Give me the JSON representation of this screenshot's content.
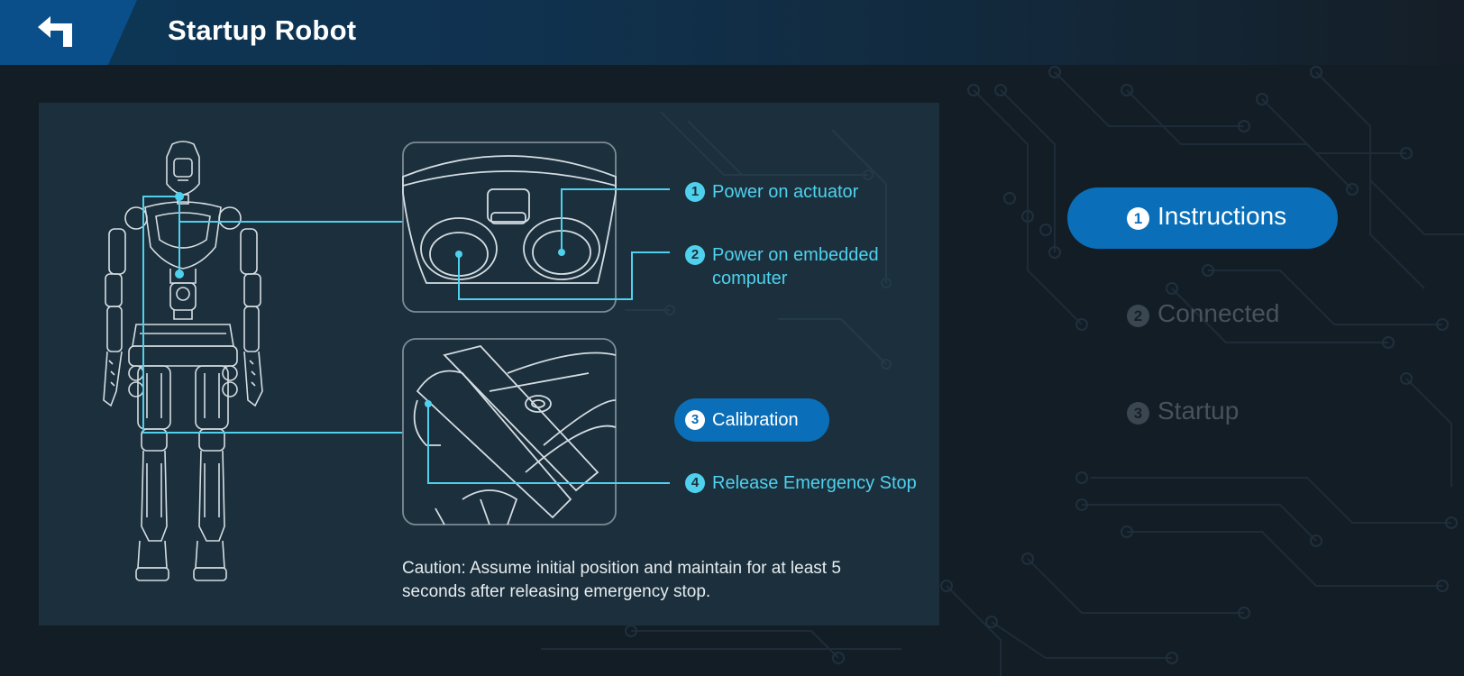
{
  "header": {
    "title": "Startup Robot",
    "back_icon": "back-arrow-icon"
  },
  "instructions": {
    "steps": [
      {
        "number": "1",
        "label": "Power on actuator"
      },
      {
        "number": "2",
        "label": "Power on embedded computer"
      },
      {
        "number": "3",
        "label": "Calibration"
      },
      {
        "number": "4",
        "label": "Release Emergency Stop"
      }
    ],
    "caution": "Caution: Assume initial position and maintain for at least 5 seconds after releasing emergency stop."
  },
  "stepper": {
    "items": [
      {
        "number": "1",
        "label": "Instructions",
        "state": "active"
      },
      {
        "number": "2",
        "label": "Connected",
        "state": "inactive"
      },
      {
        "number": "3",
        "label": "Startup",
        "state": "inactive"
      }
    ]
  },
  "colors": {
    "accent": "#0a6fb8",
    "highlight": "#4fd1ee",
    "background": "#131d26",
    "panel": "#1b2f3c"
  }
}
